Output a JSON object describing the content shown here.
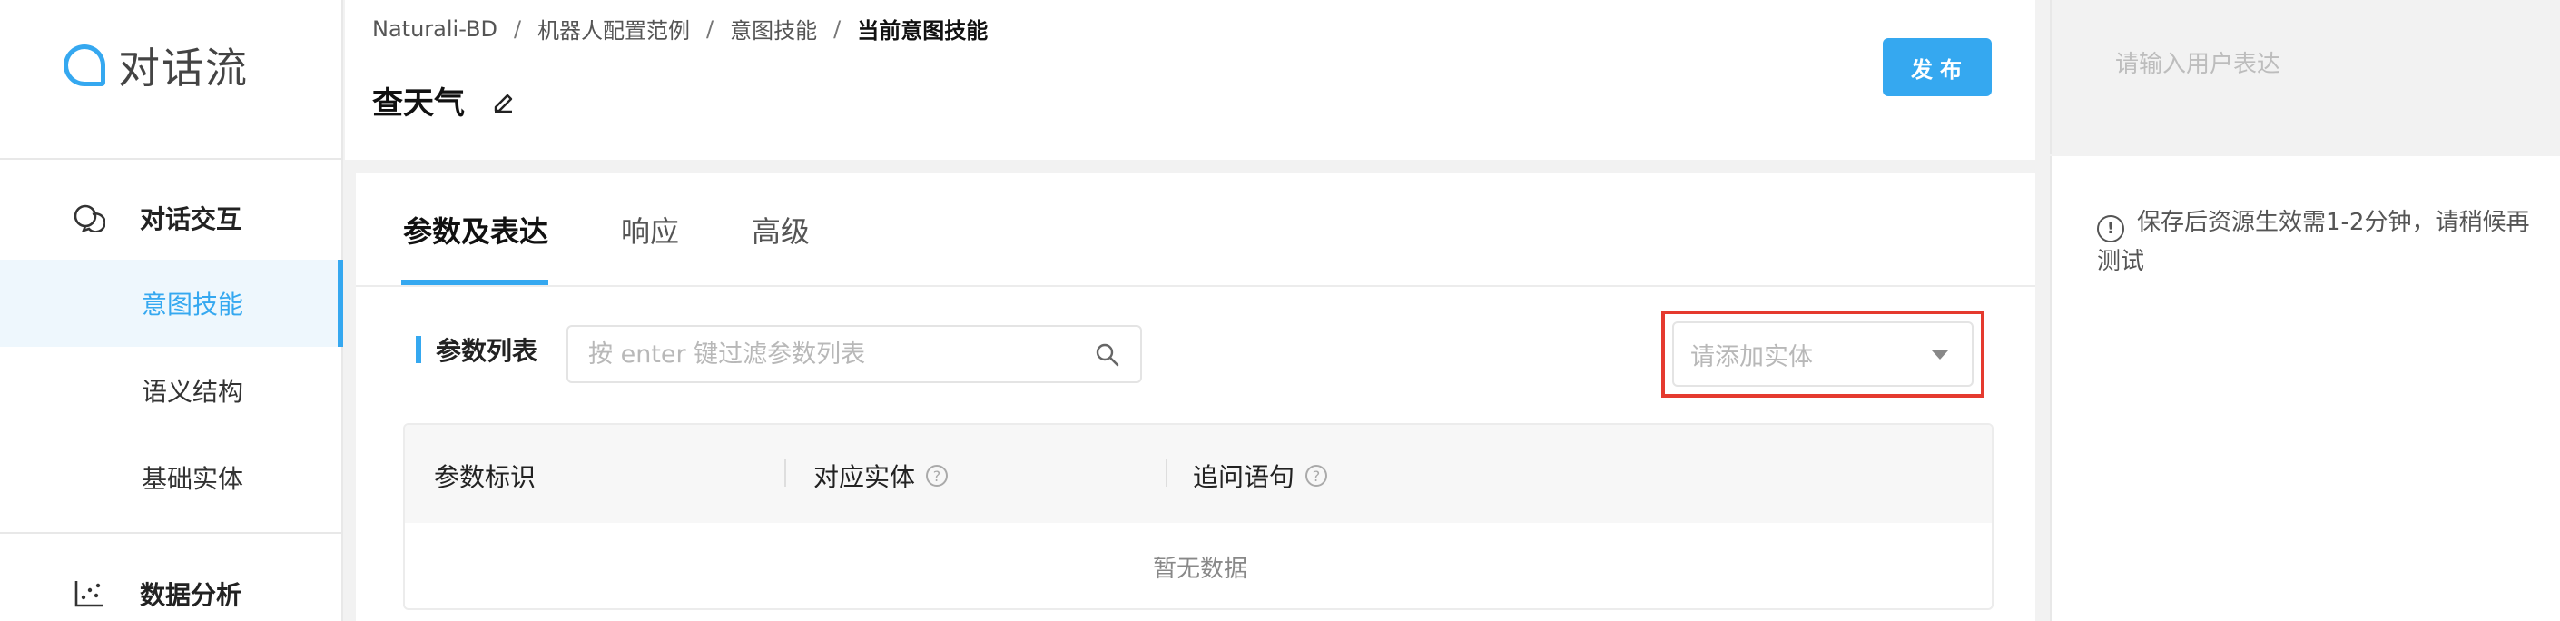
{
  "app": {
    "logo_text": "对话流"
  },
  "sidebar": {
    "group1_label": "对话交互",
    "items": [
      {
        "label": "意图技能",
        "active": true
      },
      {
        "label": "语义结构"
      },
      {
        "label": "基础实体"
      }
    ],
    "group2_label": "数据分析"
  },
  "breadcrumb": [
    {
      "label": "Naturali-BD"
    },
    {
      "label": "机器人配置范例"
    },
    {
      "label": "意图技能"
    },
    {
      "label": "当前意图技能"
    }
  ],
  "breadcrumb_sep": "/",
  "page": {
    "title": "查天气"
  },
  "header": {
    "publish_label": "发布"
  },
  "tabs": [
    {
      "label": "参数及表达",
      "active": true
    },
    {
      "label": "响应"
    },
    {
      "label": "高级"
    }
  ],
  "params": {
    "section_label": "参数列表",
    "search_placeholder": "按 enter 键过滤参数列表",
    "entity_placeholder": "请添加实体",
    "columns": [
      "参数标识",
      "对应实体",
      "追问语句"
    ],
    "help_glyph": "?",
    "empty_text": "暂无数据"
  },
  "test_panel": {
    "input_placeholder": "请输入用户表达",
    "notice_glyph": "!",
    "notice": "保存后资源生效需1-2分钟，请稍候再测试"
  },
  "colors": {
    "accent": "#35a8f0",
    "highlight_outline": "#e53a2f"
  },
  "icons": [
    "chat-bubbles-icon",
    "edit-pencil-icon",
    "search-icon",
    "chevron-down-icon",
    "help-circle-icon",
    "info-circle-icon",
    "scatter-chart-icon"
  ]
}
